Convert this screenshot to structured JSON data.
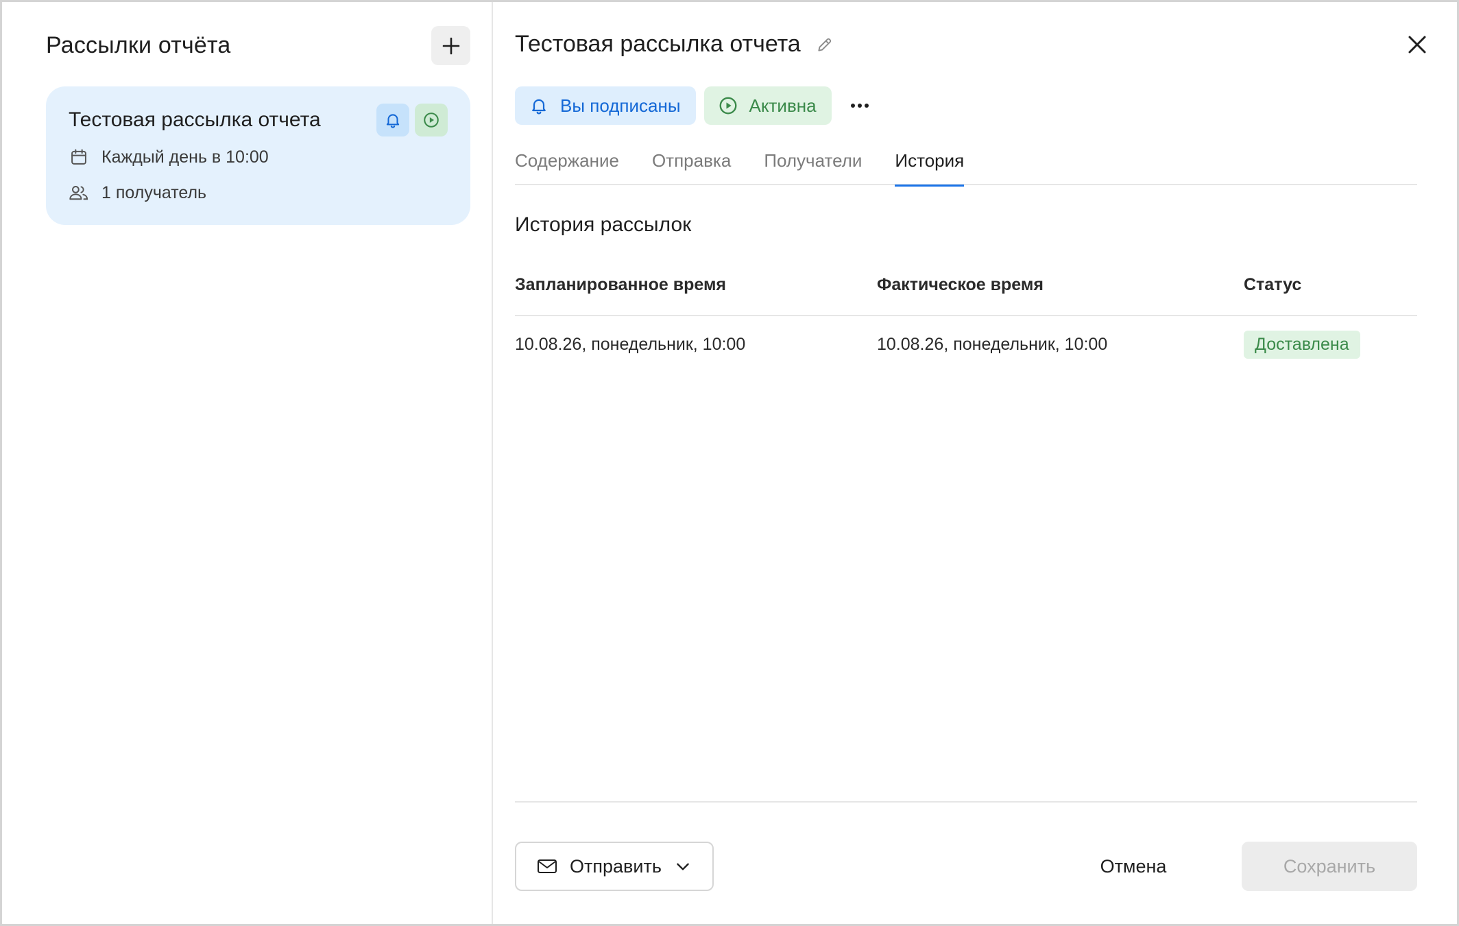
{
  "sidebar": {
    "title": "Рассылки отчёта",
    "add_icon": "plus-icon",
    "items": [
      {
        "title": "Тестовая рассылка отчета",
        "schedule": "Каждый день в 10:00",
        "recipients": "1 получатель",
        "icons": [
          "bell-icon",
          "play-icon",
          "calendar-icon",
          "users-icon"
        ]
      }
    ]
  },
  "detail": {
    "title": "Тестовая рассылка отчета",
    "badges": {
      "subscribed": "Вы подписаны",
      "active": "Активна"
    },
    "tabs": [
      {
        "label": "Содержание",
        "active": false
      },
      {
        "label": "Отправка",
        "active": false
      },
      {
        "label": "Получатели",
        "active": false
      },
      {
        "label": "История",
        "active": true
      }
    ],
    "section_title": "История рассылок",
    "table": {
      "headers": [
        "Запланированное время",
        "Фактическое время",
        "Статус"
      ],
      "rows": [
        {
          "planned": "10.08.26, понедельник, 10:00",
          "actual": "10.08.26, понедельник, 10:00",
          "status": "Доставлена"
        }
      ]
    },
    "footer": {
      "send_label": "Отправить",
      "cancel_label": "Отмена",
      "save_label": "Сохранить"
    }
  },
  "colors": {
    "accent": "#1a73e8",
    "card_bg": "#e4f1fd",
    "success_bg": "#e0f3e3",
    "success_text": "#3b8a4a"
  }
}
